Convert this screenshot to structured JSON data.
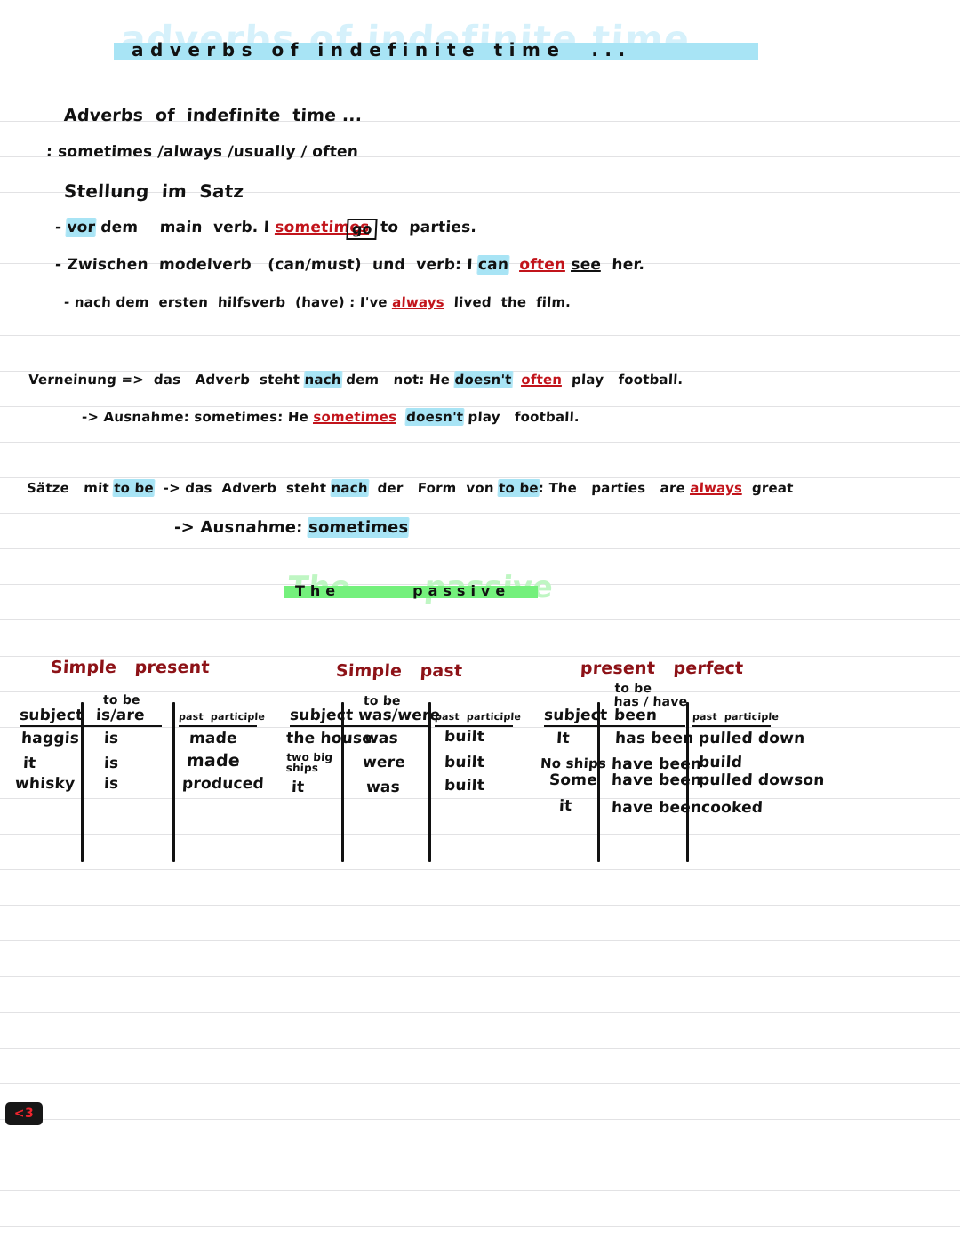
{
  "page": {
    "title_banner": {
      "text": "adverbs of indefinite time  ...",
      "highlight_color": "#a8e4f5"
    },
    "heart_badge": {
      "label": "<3",
      "background": "#171717",
      "text_color": "#f0252e"
    }
  },
  "notes": {
    "heading": "Adverbs  of  indefinite  time ...",
    "definition": ": sometimes /always /usually / often",
    "subheading": "Stellung  im  Satz",
    "rules": [
      {
        "bullet": "-",
        "lead": "vor",
        "rest": "dem    main  verb. I ",
        "adverb": "sometimes",
        "boxed_word": "go",
        "tail": "to  parties."
      },
      {
        "bullet": "-",
        "lead": "Zwischen",
        "rest": "modelverb   (can/must)  und  verb: I ",
        "highlight": "can",
        "adverb": "often",
        "tail": "see   her."
      },
      {
        "bullet": "-",
        "lead": "nach",
        "rest": "dem  ersten  hilfsverb  (have) : I've ",
        "adverb": "always",
        "tail": "lived  the  film."
      }
    ],
    "negation": {
      "lead": "Verneinung =>  das   Adverb  steht ",
      "highlight1": "nach",
      "mid": " dem   not: He ",
      "highlight2": "doesn't",
      "adverb": "often",
      "tail": "play   football.",
      "exception": {
        "lead": "-> Ausnahme: sometimes: He ",
        "adverb": "sometimes",
        "highlight": "doesn't",
        "tail": " play   football."
      }
    },
    "to_be_rule": {
      "lead": "Sätze   mit ",
      "highlight1": "to be",
      "mid": "  -> das  Adverb  steht ",
      "highlight2": "nach",
      "mid2": "  der   Form  von ",
      "highlight3": "to be",
      "mid3": ": The   parties   are ",
      "adverb": "always",
      "tail": "great",
      "exception": {
        "lead": "-> Ausnahme: ",
        "highlight": "sometimes"
      }
    }
  },
  "passive": {
    "banner_text": "The       passive",
    "highlight_color": "#74f07c",
    "tables": [
      {
        "title": "Simple   present",
        "headers": {
          "subject": "subject",
          "to_be_label": "to be",
          "to_be_form": "is/are",
          "participle": "past  participle"
        },
        "rows": [
          {
            "subject": "haggis",
            "to_be": "is",
            "participle": "made"
          },
          {
            "subject": "it",
            "to_be": "is",
            "participle": "made"
          },
          {
            "subject": "whisky",
            "to_be": "is",
            "participle": "produced"
          }
        ]
      },
      {
        "title": "Simple   past",
        "headers": {
          "subject": "subject",
          "to_be_label": "to be",
          "to_be_form": "was/were",
          "participle": "past  participle"
        },
        "rows": [
          {
            "subject": "the house",
            "to_be": "was",
            "participle": "built"
          },
          {
            "subject": "two big\nships",
            "to_be": "were",
            "participle": "built"
          },
          {
            "subject": "it",
            "to_be": "was",
            "participle": "built"
          }
        ]
      },
      {
        "title": "present   perfect",
        "headers": {
          "subject": "subject",
          "to_be_label": "to be\nhas / have",
          "to_be_form": "been",
          "participle": "past  participle"
        },
        "rows": [
          {
            "subject": "It",
            "to_be": "has been",
            "participle": "pulled down"
          },
          {
            "subject": "No ships",
            "to_be": "have been",
            "participle": "build"
          },
          {
            "subject": "Some",
            "to_be": "have been",
            "participle": "pulled dowson"
          },
          {
            "subject": "it",
            "to_be": "have been",
            "participle": "cooked"
          }
        ]
      }
    ]
  }
}
